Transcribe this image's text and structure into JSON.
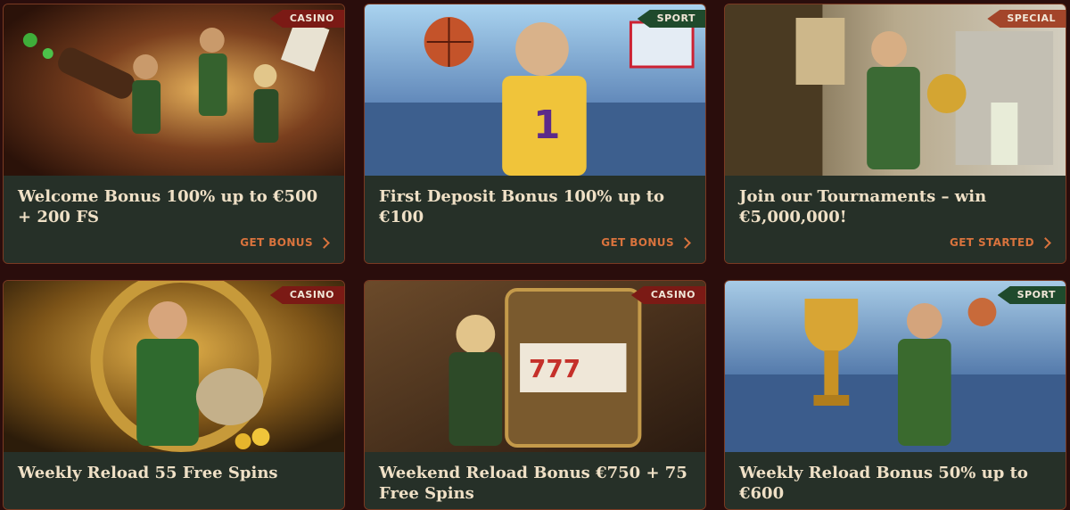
{
  "cards": [
    {
      "tag": "CASINO",
      "title": "Welcome Bonus 100% up to €500 + 200 FS",
      "cta": "GET BONUS"
    },
    {
      "tag": "SPORT",
      "title": "First Deposit Bonus 100% up to €100",
      "cta": "GET BONUS"
    },
    {
      "tag": "SPECIAL",
      "title": "Join our Tournaments – win €5,000,000!",
      "cta": "GET STARTED"
    },
    {
      "tag": "CASINO",
      "title": "Weekly Reload 55 Free Spins"
    },
    {
      "tag": "CASINO",
      "title": "Weekend Reload Bonus €750 + 75 Free Spins"
    },
    {
      "tag": "SPORT",
      "title": "Weekly Reload Bonus 50% up to €600"
    }
  ],
  "colors": {
    "casino": "#7b1a15",
    "sport": "#1f4a2c",
    "special": "#a3452a",
    "cta": "#d9733d",
    "panel": "#263028"
  }
}
